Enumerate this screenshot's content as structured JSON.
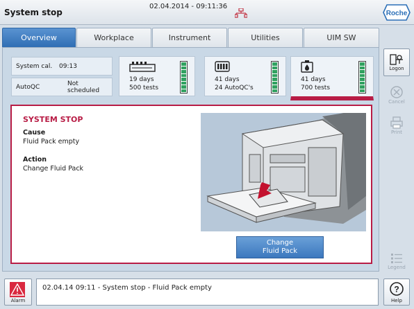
{
  "header": {
    "title": "System stop",
    "datetime": "02.04.2014 - 09:11:36",
    "logo_text": "Roche"
  },
  "tabs": [
    {
      "label": "Overview",
      "active": true
    },
    {
      "label": "Workplace",
      "active": false
    },
    {
      "label": "Instrument",
      "active": false
    },
    {
      "label": "Utilities",
      "active": false
    },
    {
      "label": "UIM SW",
      "active": false
    }
  ],
  "status": {
    "system_cal_label": "System cal.",
    "system_cal_value": "09:13",
    "autoqc_label": "AutoQC",
    "autoqc_value": "Not scheduled"
  },
  "tiles": [
    {
      "icon": "sensor-cassette-icon",
      "line1": "19 days",
      "line2": "500 tests",
      "level": 1.0
    },
    {
      "icon": "qc-cassette-icon",
      "line1": "41 days",
      "line2": "24 AutoQC's",
      "level": 1.0
    },
    {
      "icon": "fluid-pack-icon",
      "line1": "41 days",
      "line2": "700 tests",
      "level": 1.0,
      "alert": true
    }
  ],
  "stop_panel": {
    "title": "SYSTEM STOP",
    "cause_label": "Cause",
    "cause_text": "Fluid Pack empty",
    "action_label": "Action",
    "action_text": "Change Fluid Pack",
    "button_line1": "Change",
    "button_line2": "Fluid Pack"
  },
  "side_buttons": {
    "logon": "Logon",
    "cancel": "Cancel",
    "print": "Print",
    "legend": "Legend",
    "help": "Help"
  },
  "bottom": {
    "alarm_label": "Alarm",
    "message": "02.04.14 09:11 - System stop - Fluid Pack empty"
  },
  "colors": {
    "accent": "#2f6eb4",
    "alert": "#b81c45",
    "gauge": "#30a160"
  }
}
